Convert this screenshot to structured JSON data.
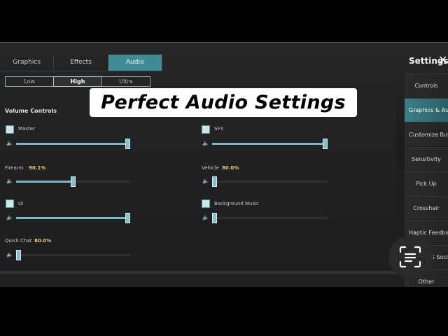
{
  "tabs": [
    {
      "label": "Graphics",
      "active": false
    },
    {
      "label": "Effects",
      "active": false
    },
    {
      "label": "Audio",
      "active": true
    }
  ],
  "title": "Settings",
  "close_icon": "close-icon",
  "quality": [
    {
      "label": "Low",
      "active": false
    },
    {
      "label": "High",
      "active": true
    },
    {
      "label": "Ultra",
      "active": false
    }
  ],
  "banner": "Perfect Audio Settings",
  "section_title": "Volume Controls",
  "controls": {
    "master": {
      "label": "Master",
      "level": 1.0
    },
    "sfx": {
      "label": "SFX",
      "level": 1.0
    },
    "firearm": {
      "label": "Firearm",
      "value": "90.1%",
      "level": 0.5
    },
    "vehicle": {
      "label": "Vehicle",
      "value": "80.0%",
      "level": 0.0
    },
    "ui": {
      "label": "UI",
      "level": 1.0
    },
    "background_music": {
      "label": "Background Music",
      "level": 0.0
    },
    "quick_chat": {
      "label": "Quick Chat",
      "value": "80.0%",
      "level": 0.0
    }
  },
  "sidebar": [
    {
      "label": "Controls",
      "active": false
    },
    {
      "label": "Graphics & Au",
      "active": true
    },
    {
      "label": "Customize Butt",
      "active": false
    },
    {
      "label": "Sensitivity",
      "active": false
    },
    {
      "label": "Pick Up",
      "active": false
    },
    {
      "label": "Crosshair",
      "active": false
    },
    {
      "label": "Haptic Feedba",
      "active": false
    },
    {
      "label": "G Soci",
      "active": false
    },
    {
      "label": "Other",
      "active": false
    }
  ],
  "colors": {
    "accent": "#3f8c96",
    "slider": "#7fb8c4",
    "percent": "#f2c77d"
  }
}
